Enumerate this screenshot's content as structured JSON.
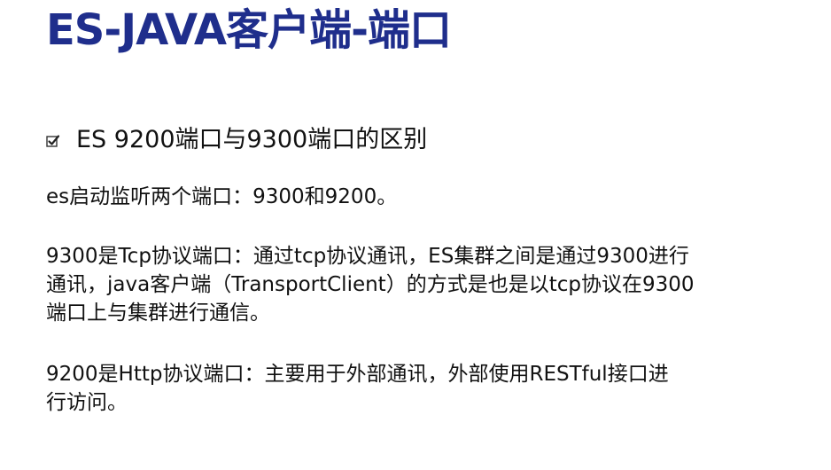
{
  "slide": {
    "title": "ES-JAVA客户端-端口",
    "subtitle": "ES 9200端口与9300端口的区别",
    "bullet_icon": "checkbox-icon",
    "paragraphs": [
      {
        "lines": [
          "es启动监听两个端口：9300和9200。"
        ]
      },
      {
        "lines": [
          "9300是Tcp协议端口：通过tcp协议通讯，ES集群之间是通过9300进行",
          "通讯，java客户端（TransportClient）的方式是也是以tcp协议在9300",
          "端口上与集群进行通信。"
        ]
      },
      {
        "lines": [
          "9200是Http协议端口：主要用于外部通讯，外部使用RESTful接口进",
          "行访问。"
        ]
      }
    ],
    "colors": {
      "title": "#1f2e8c",
      "text": "#111111",
      "background": "#ffffff"
    }
  }
}
